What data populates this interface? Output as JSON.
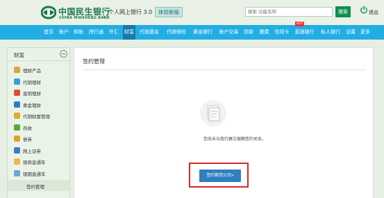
{
  "header": {
    "brand_cn": "中国民生银行",
    "brand_en": "CHINA MINSHENG BANK",
    "subtitle": "个人网上银行 3.0",
    "trial_label": "体验新版",
    "search_placeholder": "搜索 功能名称",
    "search_button": "搜索",
    "logout_label": "退出"
  },
  "nav": {
    "items": [
      "首页",
      "账户",
      "转账",
      "跨行通",
      "外汇",
      "财富",
      "代销基金",
      "代销保险",
      "黄金银行",
      "账户交易",
      "贷款",
      "缴费",
      "信用卡",
      "直销银行",
      "私人银行",
      "设置",
      "更多"
    ],
    "active_index": 5,
    "hot_badge": "HOT"
  },
  "sidebar": {
    "title": "财富",
    "items": [
      {
        "label": "理财产品",
        "icon": "chart-icon",
        "color": "#d9a63a"
      },
      {
        "label": "代销理财",
        "icon": "clock-icon",
        "color": "#3d9fd8"
      },
      {
        "label": "直销理财",
        "icon": "flower-icon",
        "color": "#e04b3c"
      },
      {
        "label": "黄金理财",
        "icon": "bar-chart-icon",
        "color": "#2e7ec4"
      },
      {
        "label": "代销财富管理",
        "icon": "coin-icon",
        "color": "#dcaa3a"
      },
      {
        "label": "存款",
        "icon": "deposit-icon",
        "color": "#5aa83c"
      },
      {
        "label": "债券",
        "icon": "bond-icon",
        "color": "#e0a12a"
      },
      {
        "label": "网上证券",
        "icon": "screen-icon",
        "color": "#3b7fc4"
      },
      {
        "label": "银商直通车",
        "icon": "card-icon",
        "color": "#e7b84a"
      },
      {
        "label": "银期直通车",
        "icon": "database-icon",
        "color": "#6fa7cf"
      }
    ],
    "sub_item": "签约管理"
  },
  "main": {
    "title": "签约管理",
    "empty_message": "您尚未与我行建立银期签约关系。",
    "sign_button": "签约期货公司»"
  }
}
